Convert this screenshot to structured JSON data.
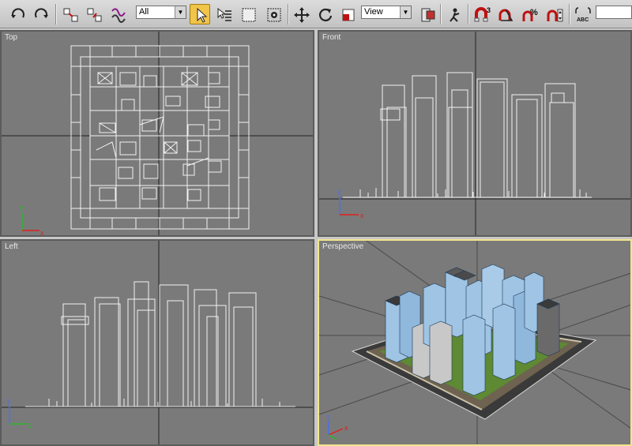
{
  "toolbar": {
    "buttons": [
      {
        "name": "undo-icon"
      },
      {
        "name": "redo-icon"
      },
      {
        "name": "link-icon"
      },
      {
        "name": "unlink-icon"
      },
      {
        "name": "bind-spacewarp-icon"
      },
      {
        "name": "select-object-icon"
      },
      {
        "name": "select-by-name-icon"
      },
      {
        "name": "rectangular-region-icon"
      },
      {
        "name": "window-crossing-icon"
      },
      {
        "name": "select-move-icon"
      },
      {
        "name": "select-rotate-icon"
      },
      {
        "name": "select-scale-icon"
      },
      {
        "name": "use-pivot-center-icon"
      },
      {
        "name": "select-manipulate-icon"
      },
      {
        "name": "snaps-toggle-icon"
      },
      {
        "name": "angle-snap-icon"
      },
      {
        "name": "percent-snap-icon"
      },
      {
        "name": "spinner-snap-icon"
      },
      {
        "name": "spell-check-icon"
      }
    ],
    "selection_filter": "All",
    "reference_coord": "View",
    "snap_label": "3",
    "spell_label": "ABC"
  },
  "viewports": {
    "top": {
      "label": "Top",
      "axis_x": "x",
      "axis_y": "y"
    },
    "front": {
      "label": "Front",
      "axis_x": "x",
      "axis_y": "z"
    },
    "left": {
      "label": "Left",
      "axis_x": "y",
      "axis_y": "z"
    },
    "perspective": {
      "label": "Perspective",
      "axis_x": "x",
      "axis_y": "z"
    }
  },
  "colors": {
    "viewport_bg": "#7a7a7a",
    "wire": "#f2f2f2",
    "active_border": "#f0e68c",
    "building": "#9fc4e4",
    "ground": "#5d8a33"
  }
}
